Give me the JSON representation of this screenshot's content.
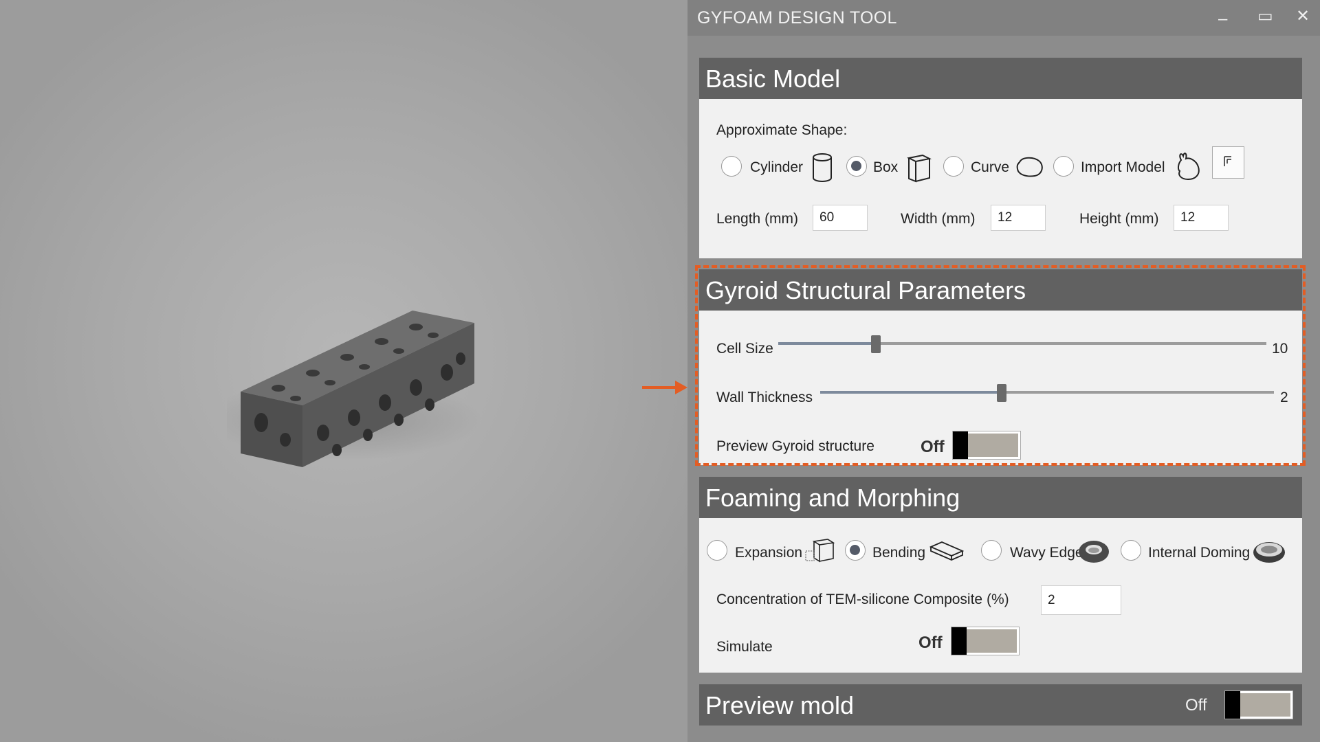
{
  "app": {
    "title": "GYFOAM DESIGN TOOL",
    "window_buttons": {
      "minimize": "–",
      "maximize": "▭",
      "close": "✕"
    }
  },
  "basic_model": {
    "header": "Basic Model",
    "shape_label": "Approximate Shape:",
    "shapes": [
      {
        "label": "Cylinder",
        "icon": "cylinder-icon",
        "selected": false
      },
      {
        "label": "Box",
        "icon": "box-icon",
        "selected": true
      },
      {
        "label": "Curve",
        "icon": "curve-blob-icon",
        "selected": false
      },
      {
        "label": "Import Model",
        "icon": "bunny-icon",
        "selected": false
      }
    ],
    "import_button_icon": "folder-import-icon",
    "length_label": "Length (mm)",
    "length_value": "60",
    "width_label": "Width (mm)",
    "width_value": "12",
    "height_label": "Height (mm)",
    "height_value": "12"
  },
  "gyroid": {
    "header": "Gyroid Structural Parameters",
    "cell_size_label": "Cell Size",
    "cell_size_value": "10",
    "cell_size_fraction": 0.2,
    "wall_thickness_label": "Wall Thickness",
    "wall_thickness_value": "2",
    "wall_thickness_fraction": 0.4,
    "preview_label": "Preview Gyroid structure",
    "preview_toggle": "Off"
  },
  "foaming": {
    "header": "Foaming and Morphing",
    "options": [
      {
        "label": "Expansion",
        "icon": "expansion-cube-icon",
        "selected": false
      },
      {
        "label": "Bending",
        "icon": "bending-plate-icon",
        "selected": true
      },
      {
        "label": "Wavy Edges",
        "icon": "wavy-edge-disc-icon",
        "selected": false
      },
      {
        "label": "Internal Doming",
        "icon": "doming-disc-icon",
        "selected": false
      }
    ],
    "concentration_label": "Concentration of TEM-silicone Composite  (%)",
    "concentration_value": "2",
    "simulate_label": "Simulate",
    "simulate_toggle": "Off"
  },
  "preview_mold": {
    "header": "Preview mold",
    "toggle": "Off"
  },
  "colors": {
    "accent_highlight": "#e35d24",
    "section_header": "#616161",
    "panel_bg": "#8c8c8c"
  }
}
